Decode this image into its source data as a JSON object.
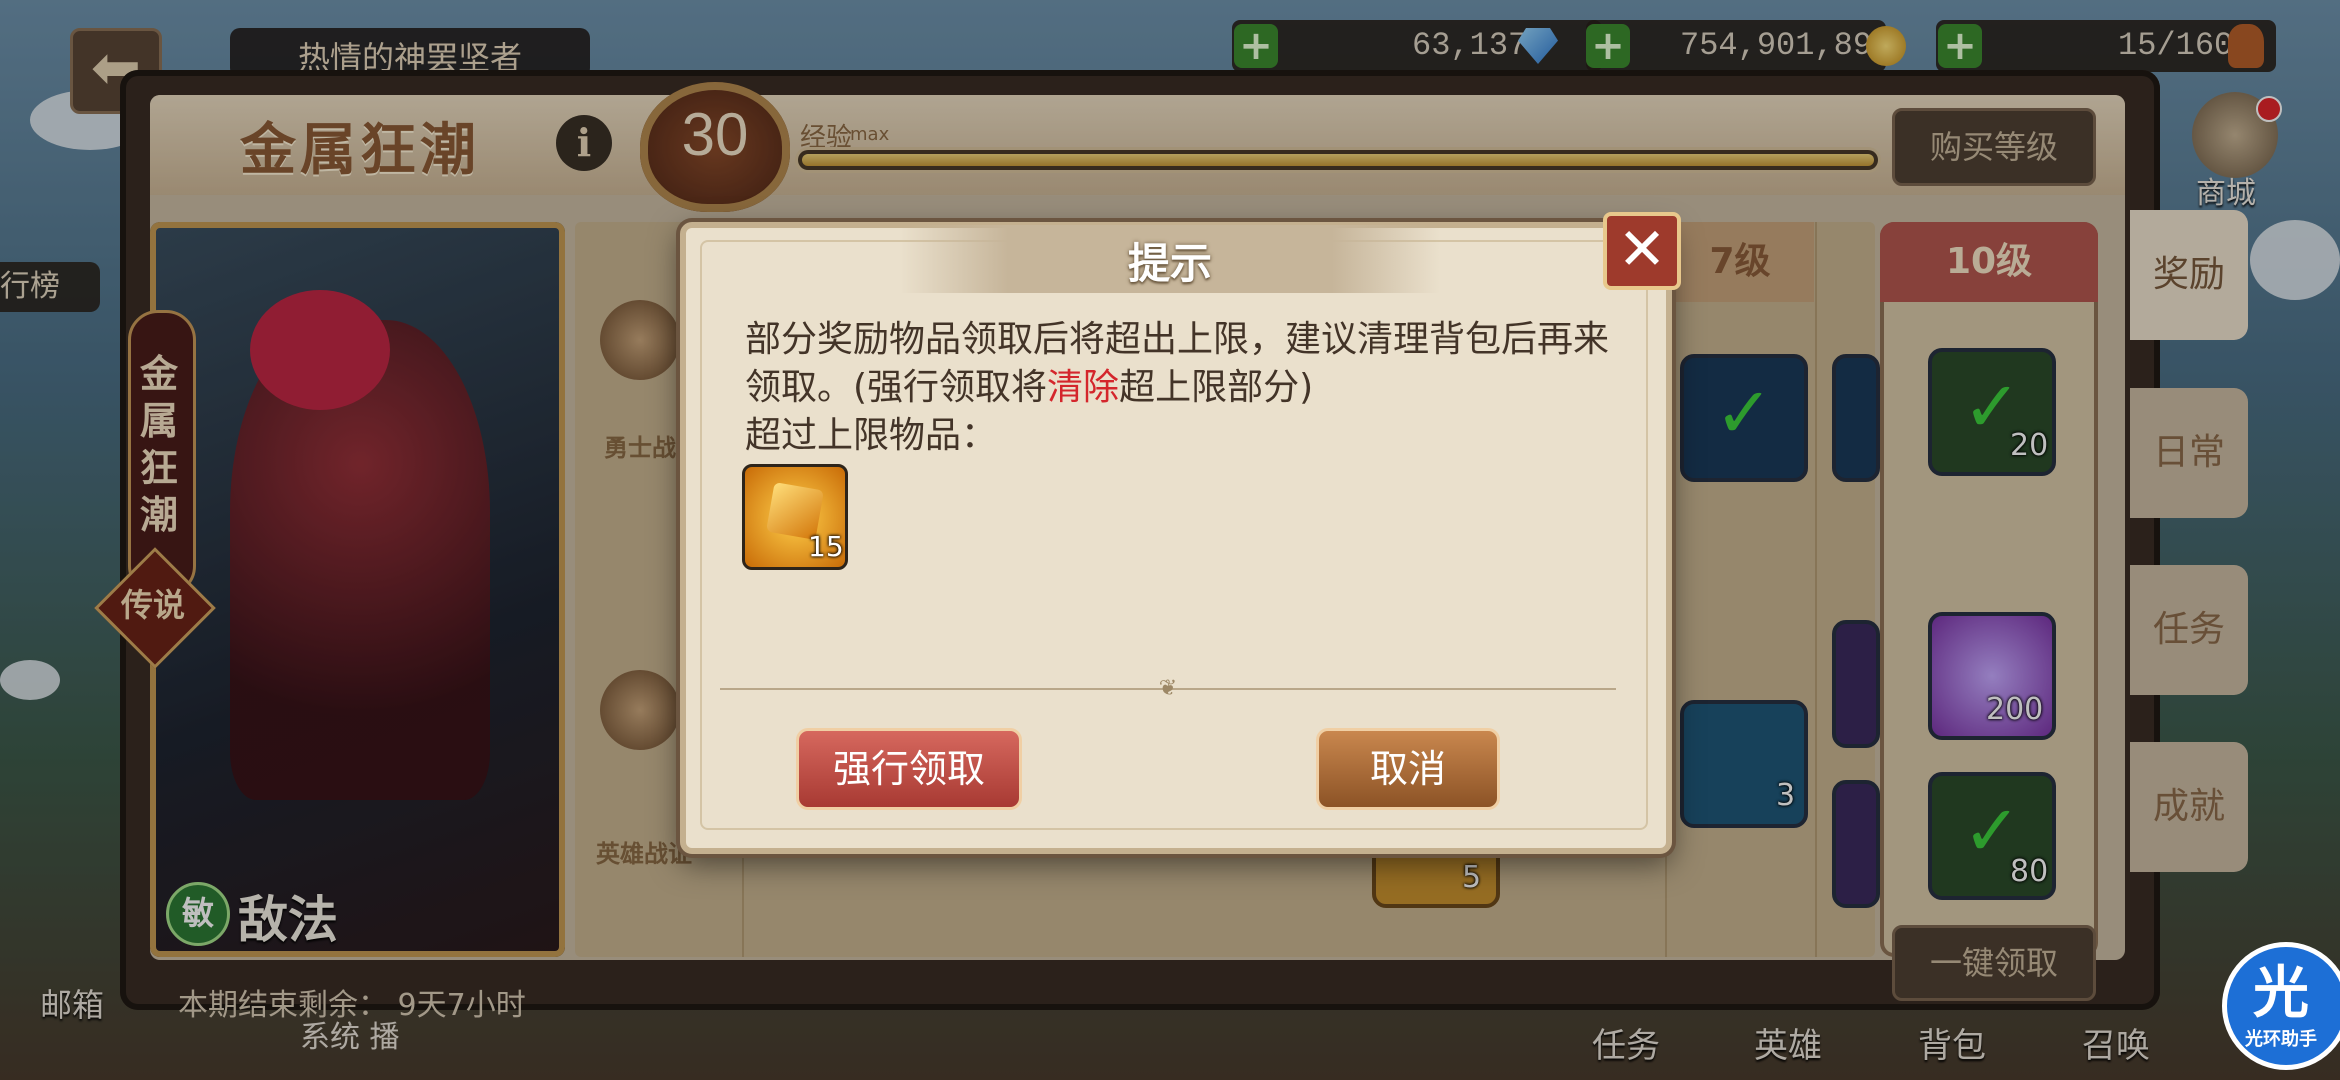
{
  "top_bar": {
    "title": "热情的神罢坚者",
    "gems": "63,137",
    "gold": "754,901,893",
    "stamina": "15/160",
    "shop_label": "商城"
  },
  "event": {
    "name": "金属狂潮",
    "level": "30",
    "exp_label": "经验",
    "exp_state": "max",
    "exp_progress": 1.0,
    "buy_level_label": "购买等级"
  },
  "hero": {
    "banner": "金属狂潮",
    "rarity": "传说",
    "class_badge": "敏",
    "name": "敌法"
  },
  "period_text": "本期结束剩余：  9天7小时",
  "tiers": {
    "warrior_label": "勇士战",
    "hero_label": "英雄战证",
    "col7": "7级",
    "col10": "10级",
    "items": {
      "col7_top_count": "",
      "col7_mid_count": "3",
      "col_pre_count": "5",
      "col10_top_count": "20",
      "col10_mid_count": "200",
      "col10_bot_count": "80"
    }
  },
  "claim_all_label": "一键领取",
  "side_tabs": [
    "奖励",
    "日常",
    "任务",
    "成就"
  ],
  "left_side": {
    "rank": "行榜",
    "mail": "邮箱"
  },
  "chat": "系统  播",
  "bottom_nav": [
    "任务",
    "英雄",
    "背包",
    "召唤"
  ],
  "assistant": {
    "char": "光",
    "label": "光环助手"
  },
  "dialog": {
    "title": "提示",
    "line1": "部分奖励物品领取后将超出上限，建议清理背包后再来",
    "line2_pre": "领取。(强行领取将",
    "line2_hl": "清除",
    "line2_post": "超上限部分)",
    "line3": "超过上限物品：",
    "item_count": "15",
    "force_button": "强行领取",
    "cancel_button": "取消",
    "close": "✕"
  },
  "colors": {
    "highlight": "#d4262c",
    "accent": "#c49a53"
  }
}
